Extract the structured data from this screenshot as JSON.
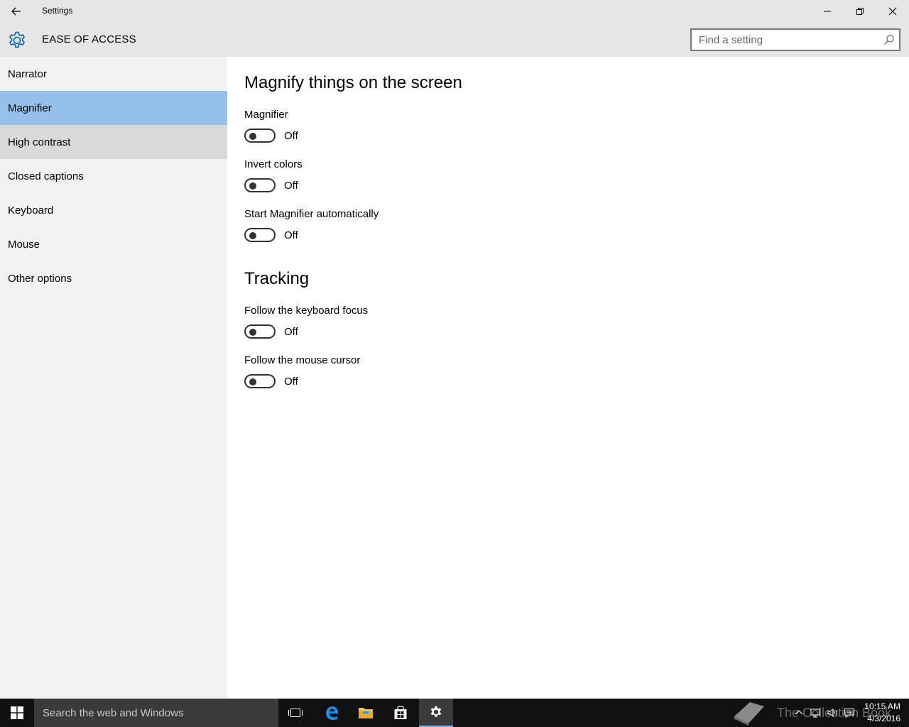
{
  "window": {
    "title": "Settings",
    "back_icon": "back-arrow-icon",
    "controls": [
      "minimize-icon",
      "restore-icon",
      "close-icon"
    ]
  },
  "header": {
    "icon": "gear-icon",
    "title": "EASE OF ACCESS",
    "search_placeholder": "Find a setting",
    "search_icon": "search-icon"
  },
  "sidebar": {
    "items": [
      {
        "label": "Narrator"
      },
      {
        "label": "Magnifier"
      },
      {
        "label": "High contrast"
      },
      {
        "label": "Closed captions"
      },
      {
        "label": "Keyboard"
      },
      {
        "label": "Mouse"
      },
      {
        "label": "Other options"
      }
    ]
  },
  "main": {
    "section1_title": "Magnify things on the screen",
    "section2_title": "Tracking",
    "settings": [
      {
        "label": "Magnifier",
        "state": "Off"
      },
      {
        "label": "Invert colors",
        "state": "Off"
      },
      {
        "label": "Start Magnifier automatically",
        "state": "Off"
      },
      {
        "label": "Follow the keyboard focus",
        "state": "Off"
      },
      {
        "label": "Follow the mouse cursor",
        "state": "Off"
      }
    ]
  },
  "taskbar": {
    "search_placeholder": "Search the web and Windows",
    "apps": [
      "task-view-icon",
      "edge-icon",
      "file-explorer-icon",
      "store-icon",
      "settings-icon"
    ],
    "watermark_text": "The Collection Book",
    "time": "10:15 AM",
    "date": "4/3/2016"
  },
  "colors": {
    "selected_nav": "#94c0e9",
    "hover_nav": "#dadada",
    "sidebar_bg": "#f2f2f2",
    "chrome_bg": "#e6e6e6",
    "accent": "#0063b1"
  }
}
